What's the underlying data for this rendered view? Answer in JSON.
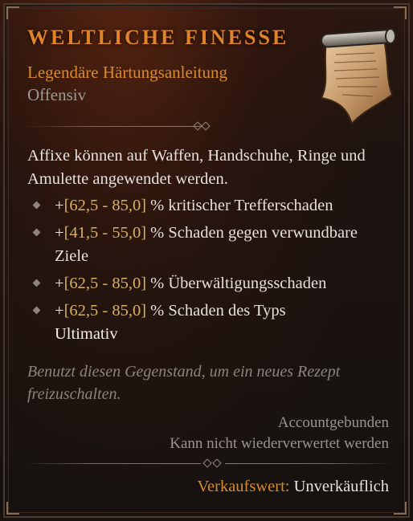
{
  "item": {
    "name": "WELTLICHE FINESSE",
    "subtitle": "Legendäre Härtungsanleitung",
    "category": "Offensiv",
    "icon": "scroll-icon"
  },
  "description": "Affixe können auf Waffen, Handschuhe, Ringe und Amulette angewendet werden.",
  "affixes": [
    {
      "prefix": "+",
      "range": "[62,5 - 85,0]",
      "suffix": " % kritischer Trefferschaden",
      "cont": ""
    },
    {
      "prefix": "+",
      "range": "[41,5 - 55,0]",
      "suffix": " % Schaden gegen verwundbare Ziele",
      "cont": ""
    },
    {
      "prefix": "+",
      "range": "[62,5 - 85,0]",
      "suffix": " % Überwältigungsschaden",
      "cont": ""
    },
    {
      "prefix": "+",
      "range": "[62,5 - 85,0]",
      "suffix": " % Schaden des Typs",
      "cont": "Ultimativ"
    }
  ],
  "flavor": "Benutzt diesen Gegenstand, um ein neues Rezept freizuschalten.",
  "binding": {
    "line1": "Accountgebunden",
    "line2": "Kann nicht wiederverwertet werden"
  },
  "sell": {
    "label": "Verkaufswert:",
    "value": " Unverkäuflich"
  },
  "colors": {
    "legendary": "#e0842c",
    "range": "#d8b060",
    "text": "#e6e1dc"
  }
}
